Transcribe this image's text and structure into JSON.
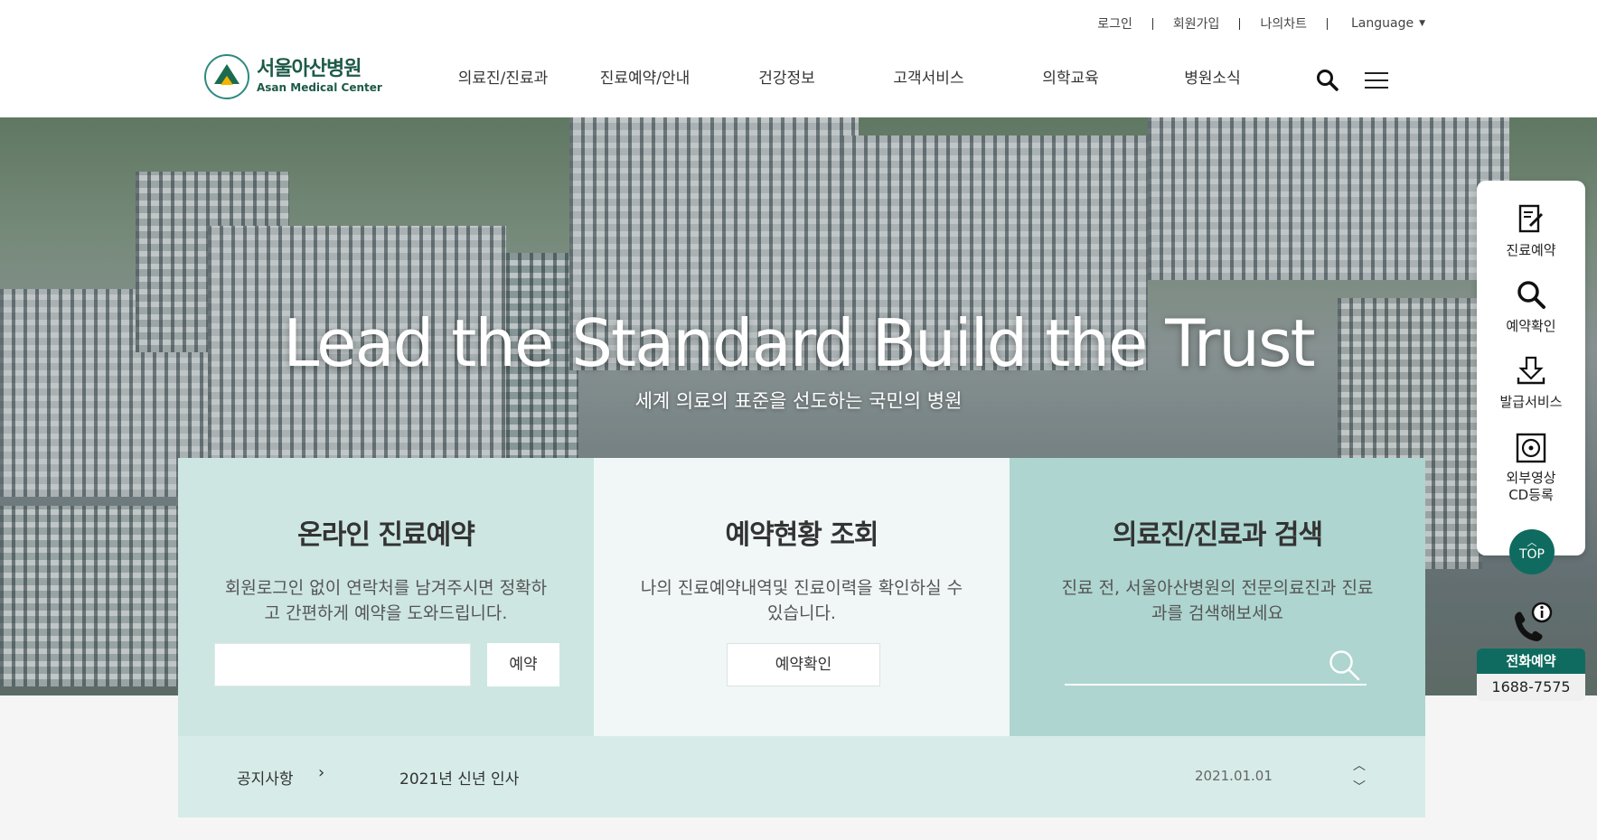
{
  "header": {
    "util": [
      "로그인",
      "회원가입",
      "나의차트"
    ],
    "language": "Language",
    "logo_ko": "서울아산병원",
    "logo_en": "Asan Medical Center",
    "nav": [
      "의료진/진료과",
      "진료예약/안내",
      "건강정보",
      "고객서비스",
      "의학교육",
      "병원소식"
    ]
  },
  "hero": {
    "title": "Lead the Standard Build the Trust",
    "subtitle": "세계 의료의 표준을 선도하는 국민의 병원"
  },
  "panels": [
    {
      "title": "온라인 진료예약",
      "desc": "회원로그인 없이 연락처를 남겨주시면 정확하고 간편하게 예약을 도와드립니다.",
      "button": "예약"
    },
    {
      "title": "예약현황 조회",
      "desc": "나의 진료예약내역및 진료이력을 확인하실 수 있습니다.",
      "button": "예약확인"
    },
    {
      "title": "의료진/진료과 검색",
      "desc": "진료 전, 서울아산병원의 전문의료진과 진료과를 검색해보세요"
    }
  ],
  "notice": {
    "label": "공지사항",
    "title": "2021년 신년 인사",
    "date": "2021.01.01"
  },
  "quick": {
    "items": [
      "진료예약",
      "예약확인",
      "발급서비스",
      "외부영상\nCD등록"
    ],
    "top": "TOP",
    "phone_label": "전화예약",
    "phone_number": "1688-7575"
  },
  "colors": {
    "brand": "#0f6b5f",
    "panel1": "#cde6e2",
    "panel2": "#f0f7f6",
    "panel3": "#aed5d0"
  }
}
